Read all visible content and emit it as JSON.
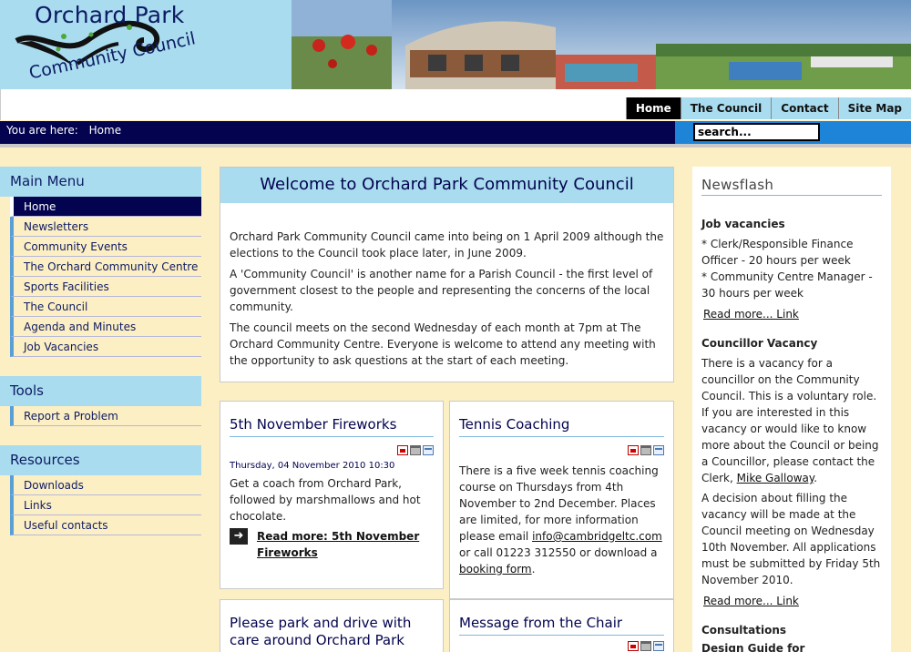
{
  "header": {
    "logo_line1": "Orchard Park",
    "logo_line2": "Community Council"
  },
  "topnav": [
    {
      "label": "Home",
      "active": true
    },
    {
      "label": "The Council"
    },
    {
      "label": "Contact"
    },
    {
      "label": "Site Map"
    }
  ],
  "breadcrumb": {
    "prefix": "You are here:",
    "current": "Home"
  },
  "search": {
    "value": "search..."
  },
  "main_menu": {
    "title": "Main Menu",
    "items": [
      "Home",
      "Newsletters",
      "Community Events",
      "The Orchard Community Centre",
      "Sports Facilities",
      "The Council",
      "Agenda and Minutes",
      "Job Vacancies"
    ]
  },
  "tools": {
    "title": "Tools",
    "items": [
      "Report a Problem"
    ]
  },
  "resources": {
    "title": "Resources",
    "items": [
      "Downloads",
      "Links",
      "Useful contacts"
    ]
  },
  "welcome": {
    "title": "Welcome to Orchard Park Community Council",
    "p1": "Orchard Park Community Council came into being on 1 April 2009 although the elections to the Council took place later, in June 2009.",
    "p2": "A 'Community Council'  is another name for a Parish Council - the first level of government closest to the people and representing the concerns of the local community.",
    "p3": "The council meets on the second Wednesday of each month at 7pm at The Orchard Community Centre. Everyone is welcome to attend any meeting with the opportunity to ask questions at the start of each meeting."
  },
  "article1": {
    "title": "5th November Fireworks",
    "date": "Thursday, 04 November 2010 10:30",
    "body": "Get a coach from Orchard Park, followed by marshmallows and hot chocolate.",
    "readmore": "Read more: 5th November Fireworks"
  },
  "article2": {
    "title": "Tennis Coaching",
    "body_start": "There is a five week tennis coaching course on Thursdays from 4th November to 2nd December. Places are limited, for more information please email",
    "email": "info@cambridgeltc.com",
    "body_mid": "or call 01223 312550 or download a",
    "link": "booking form",
    "body_end": "."
  },
  "article3": {
    "title": "Please park and drive with care around Orchard Park"
  },
  "article4": {
    "title": "Message from the Chair"
  },
  "newsflash": {
    "title": "Newsflash",
    "h1": "Job vacancies",
    "job1": "* Clerk/Responsible Finance Officer - 20 hours per week",
    "job2": "* Community Centre Manager - 30 hours per week",
    "read1": "Read more... Link",
    "h2": "Councillor Vacancy",
    "cv_text": "There is a vacancy for a councillor on the Community Council. This is a voluntary role. If you are interested in this vacancy or would like to know more about the Council or being a Councillor, please contact the Clerk,",
    "cv_link": "Mike Galloway",
    "cv_end": ".",
    "decision": "A decision about filling the vacancy will be made at the Council meeting on Wednesday 10th November. All applications must be submitted by Friday 5th November 2010.",
    "read2": "Read more... Link",
    "h3": "Consultations",
    "h4": "Design Guide for"
  },
  "colors": {
    "light_blue": "#a9dcef",
    "navy": "#03034f",
    "cream": "#fdefc4",
    "search_blue": "#1d84d8"
  }
}
